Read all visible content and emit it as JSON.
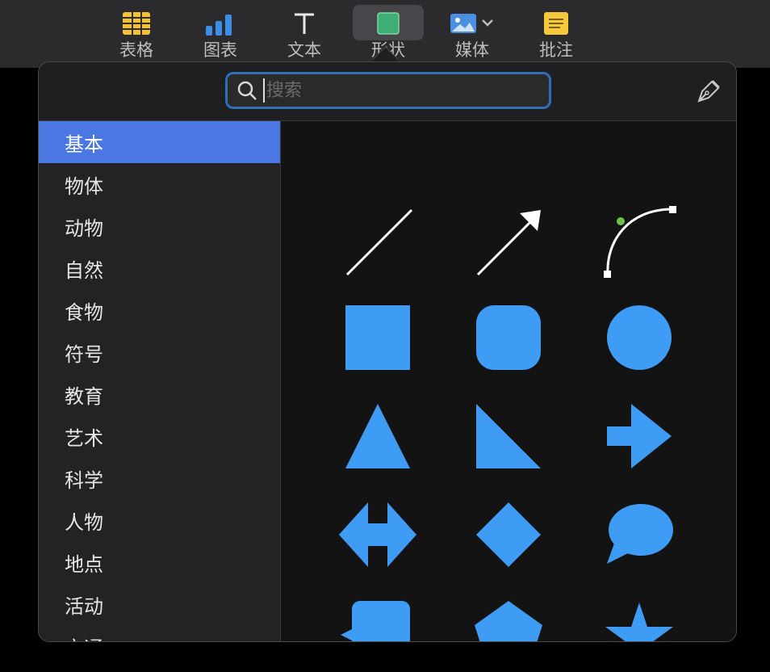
{
  "toolbar": {
    "items": [
      {
        "label": "表格",
        "icon": "table-icon"
      },
      {
        "label": "图表",
        "icon": "chart-icon"
      },
      {
        "label": "文本",
        "icon": "text-icon"
      },
      {
        "label": "形状",
        "icon": "shape-icon"
      },
      {
        "label": "媒体",
        "icon": "media-icon"
      },
      {
        "label": "批注",
        "icon": "comment-icon"
      }
    ]
  },
  "search": {
    "placeholder": "搜索",
    "value": ""
  },
  "categories": [
    "基本",
    "物体",
    "动物",
    "自然",
    "食物",
    "符号",
    "教育",
    "艺术",
    "科学",
    "人物",
    "地点",
    "活动",
    "交通"
  ],
  "selected_category": "基本",
  "shapes": [
    "line",
    "arrow-line",
    "curve",
    "square",
    "rounded-square",
    "circle",
    "triangle",
    "right-triangle",
    "arrow-right",
    "double-arrow",
    "diamond",
    "speech-bubble",
    "callout-square",
    "pentagon",
    "star"
  ],
  "colors": {
    "shape_fill": "#3f9cf4",
    "accent": "#4a77e1",
    "search_border": "#2f6fb5"
  }
}
